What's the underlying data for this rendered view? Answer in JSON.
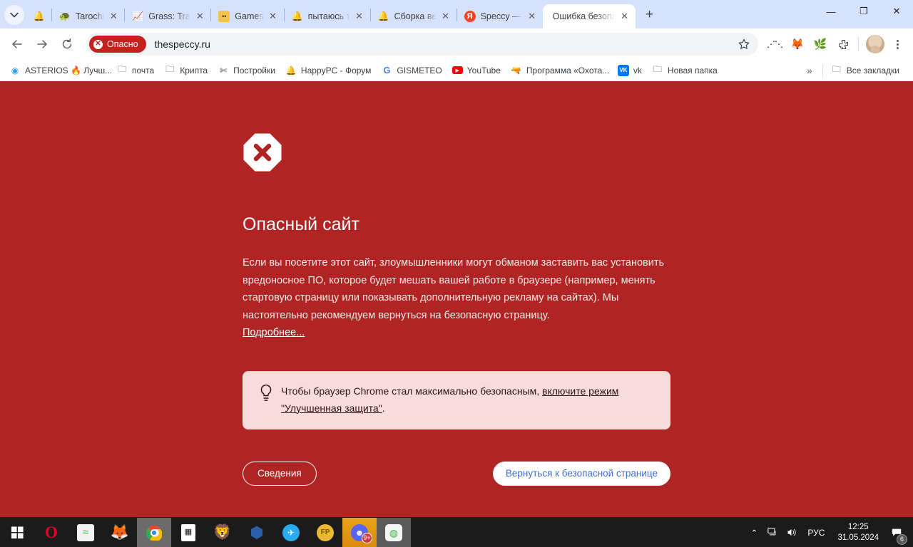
{
  "window": {
    "tab_search_icon": "chevron-down-icon",
    "pinned_tab_icon": "blue-bell-icon",
    "new_tab_label": "+",
    "controls": {
      "minimize": "—",
      "maximize": "❐",
      "close": "✕"
    },
    "tabs": [
      {
        "title": "Tarochi",
        "icon": "turtle-icon",
        "close": "✕",
        "active": false
      },
      {
        "title": "Grass: Track Y",
        "icon": "green-chart-icon",
        "close": "✕",
        "active": false
      },
      {
        "title": "Games",
        "icon": "yellow-face-icon",
        "close": "✕",
        "active": false
      },
      {
        "title": "пытаюсь тем",
        "icon": "blue-bell-icon",
        "close": "✕",
        "active": false
      },
      {
        "title": "Сборка века",
        "icon": "blue-bell-icon",
        "close": "✕",
        "active": false
      },
      {
        "title": "Speccy — Ян",
        "icon": "yandex-icon",
        "close": "✕",
        "active": false
      },
      {
        "title": "Ошибка безопас",
        "icon": "",
        "close": "✕",
        "active": true
      }
    ]
  },
  "toolbar": {
    "back_icon": "arrow-left-icon",
    "forward_icon": "arrow-right-icon",
    "reload_icon": "reload-icon",
    "security_badge": "Опасно",
    "url": "thespeccy.ru",
    "bookmark_icon": "star-icon",
    "extensions": [
      {
        "name": "extension-dots-icon",
        "glyph": "••"
      },
      {
        "name": "metamask-icon",
        "glyph": "🦊"
      },
      {
        "name": "green-extension-icon",
        "glyph": "🌿"
      },
      {
        "name": "puzzle-extension-icon",
        "glyph": "🧩"
      }
    ],
    "profile_avatar": "avatar",
    "menu_icon": "kebab-menu-icon"
  },
  "bookmarks": {
    "items": [
      {
        "label": "ASTERIOS 🔥 Лучш...",
        "icon": "asterios-icon"
      },
      {
        "label": "почта",
        "icon": "folder-icon"
      },
      {
        "label": "Крипта",
        "icon": "folder-icon"
      },
      {
        "label": "Постройки",
        "icon": "crossed-tools-icon"
      },
      {
        "label": "HappyPC - Форум",
        "icon": "blue-bell-icon"
      },
      {
        "label": "GISMETEO",
        "icon": "google-g-icon"
      },
      {
        "label": "YouTube",
        "icon": "youtube-icon"
      },
      {
        "label": "Программа «Охота...",
        "icon": "gun-icon"
      },
      {
        "label": "vk",
        "icon": "vk-icon"
      },
      {
        "label": "Новая папка",
        "icon": "folder-icon"
      }
    ],
    "overflow_icon": "double-chevron-right-icon",
    "all_bookmarks_label": "Все закладки",
    "all_bookmarks_icon": "folder-icon"
  },
  "page": {
    "background_color": "#b02423",
    "icon": "stop-octagon-x-icon",
    "title": "Опасный сайт",
    "body_text": "Если вы посетите этот сайт, злоумышленники могут обманом заставить вас установить вредоносное ПО, которое будет мешать вашей работе в браузере (например, менять стартовую страницу или показывать дополнительную рекламу на сайтах). Мы настоятельно рекомендуем вернуться на безопасную страницу.",
    "details_link": "Подробнее...",
    "tip": {
      "icon": "lightbulb-icon",
      "text_before": "Чтобы браузер Chrome стал максимально безопасным, ",
      "link_text": "включите режим \"Улучшенная защита\"",
      "text_after": "."
    },
    "buttons": {
      "details": "Сведения",
      "back_to_safety": "Вернуться к безопасной странице"
    },
    "button_primary_text_color": "#3c6fd8"
  },
  "taskbar": {
    "items": [
      {
        "name": "start-button",
        "glyph": "⊞"
      },
      {
        "name": "opera-icon",
        "glyph": "O"
      },
      {
        "name": "wifi-app-icon",
        "glyph": "📶"
      },
      {
        "name": "firefox-icon",
        "glyph": "🦊"
      },
      {
        "name": "chrome-icon",
        "glyph": "◉"
      },
      {
        "name": "calculator-icon",
        "glyph": "🖩"
      },
      {
        "name": "brave-icon",
        "glyph": "🦁"
      },
      {
        "name": "cube-app-icon",
        "glyph": "⬣"
      },
      {
        "name": "telegram-icon",
        "glyph": "✈"
      },
      {
        "name": "fp-coin-icon",
        "glyph": "FP"
      },
      {
        "name": "discord-icon",
        "glyph": "☺"
      },
      {
        "name": "green-app-icon",
        "glyph": "◍"
      }
    ],
    "discord_badge": "9+",
    "tray": {
      "chevron_icon": "chevron-up-icon",
      "network_icon": "network-icon",
      "volume_icon": "volume-icon",
      "language": "РУС",
      "time": "12:25",
      "date": "31.05.2024",
      "notification_icon": "notification-icon",
      "notification_count": "6"
    }
  }
}
